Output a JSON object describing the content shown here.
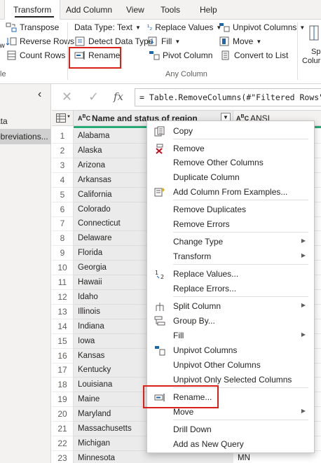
{
  "ribbon": {
    "tabs": [
      "Transform",
      "Add Column",
      "View",
      "Tools",
      "Help"
    ],
    "table_group": {
      "transpose": "Transpose",
      "reverse_rows": "Reverse Rows",
      "count_rows": "Count Rows",
      "label_partial": "le",
      "frag_use": "ow"
    },
    "any_column": {
      "data_type": "Data Type: Text",
      "detect_data_type": "Detect Data Type",
      "rename": "Rename",
      "replace_values": "Replace Values",
      "fill": "Fill",
      "pivot_column": "Pivot Column",
      "unpivot_columns": "Unpivot Columns",
      "move": "Move",
      "convert_to_list": "Convert to List",
      "group_label": "Any Column"
    },
    "split_partial": {
      "line1": "Sp",
      "line2": "Colur"
    }
  },
  "nav": {
    "items": [
      "ata",
      "bbreviations..."
    ]
  },
  "formula_bar": {
    "cancel": "✕",
    "accept": "✓",
    "fx": "fx",
    "formula": "= Table.RemoveColumns(#\"Filtered Rows\",{"
  },
  "grid": {
    "col1_header": "Name and status of region",
    "col1_type": "ABC",
    "col2_header": "ANSI",
    "col2_type": "ABC",
    "rows": [
      {
        "n": "1",
        "name": "Alabama",
        "ansi": ""
      },
      {
        "n": "2",
        "name": "Alaska",
        "ansi": ""
      },
      {
        "n": "3",
        "name": "Arizona",
        "ansi": ""
      },
      {
        "n": "4",
        "name": "Arkansas",
        "ansi": ""
      },
      {
        "n": "5",
        "name": "California",
        "ansi": ""
      },
      {
        "n": "6",
        "name": "Colorado",
        "ansi": ""
      },
      {
        "n": "7",
        "name": "Connecticut",
        "ansi": ""
      },
      {
        "n": "8",
        "name": "Delaware",
        "ansi": ""
      },
      {
        "n": "9",
        "name": "Florida",
        "ansi": ""
      },
      {
        "n": "10",
        "name": "Georgia",
        "ansi": ""
      },
      {
        "n": "11",
        "name": "Hawaii",
        "ansi": ""
      },
      {
        "n": "12",
        "name": "Idaho",
        "ansi": ""
      },
      {
        "n": "13",
        "name": "Illinois",
        "ansi": ""
      },
      {
        "n": "14",
        "name": "Indiana",
        "ansi": ""
      },
      {
        "n": "15",
        "name": "Iowa",
        "ansi": ""
      },
      {
        "n": "16",
        "name": "Kansas",
        "ansi": ""
      },
      {
        "n": "17",
        "name": "Kentucky",
        "ansi": ""
      },
      {
        "n": "18",
        "name": "Louisiana",
        "ansi": ""
      },
      {
        "n": "19",
        "name": "Maine",
        "ansi": ""
      },
      {
        "n": "20",
        "name": "Maryland",
        "ansi": ""
      },
      {
        "n": "21",
        "name": "Massachusetts",
        "ansi": ""
      },
      {
        "n": "22",
        "name": "Michigan",
        "ansi": ""
      },
      {
        "n": "23",
        "name": "Minnesota",
        "ansi": "MN"
      }
    ]
  },
  "context_menu": {
    "items": [
      {
        "label": "Copy",
        "icon": "copy-icon"
      },
      {
        "label": "Remove",
        "icon": "remove-icon"
      },
      {
        "label": "Remove Other Columns"
      },
      {
        "label": "Duplicate Column"
      },
      {
        "label": "Add Column From Examples...",
        "icon": "examples-icon"
      },
      {
        "label": "Remove Duplicates"
      },
      {
        "label": "Remove Errors"
      },
      {
        "label": "Change Type",
        "submenu": true
      },
      {
        "label": "Transform",
        "submenu": true
      },
      {
        "label": "Replace Values...",
        "icon": "replace-icon"
      },
      {
        "label": "Replace Errors..."
      },
      {
        "label": "Split Column",
        "icon": "split-icon",
        "submenu": true
      },
      {
        "label": "Group By...",
        "icon": "group-icon"
      },
      {
        "label": "Fill",
        "submenu": true
      },
      {
        "label": "Unpivot Columns",
        "icon": "unpivot-icon"
      },
      {
        "label": "Unpivot Other Columns"
      },
      {
        "label": "Unpivot Only Selected Columns"
      },
      {
        "label": "Rename...",
        "icon": "rename-icon"
      },
      {
        "label": "Move",
        "submenu": true
      },
      {
        "label": "Drill Down"
      },
      {
        "label": "Add as New Query"
      }
    ]
  },
  "colors": {
    "highlight": "#d9211a",
    "quality_bar": "#2aa876",
    "accent_blue": "#1a66b3"
  }
}
